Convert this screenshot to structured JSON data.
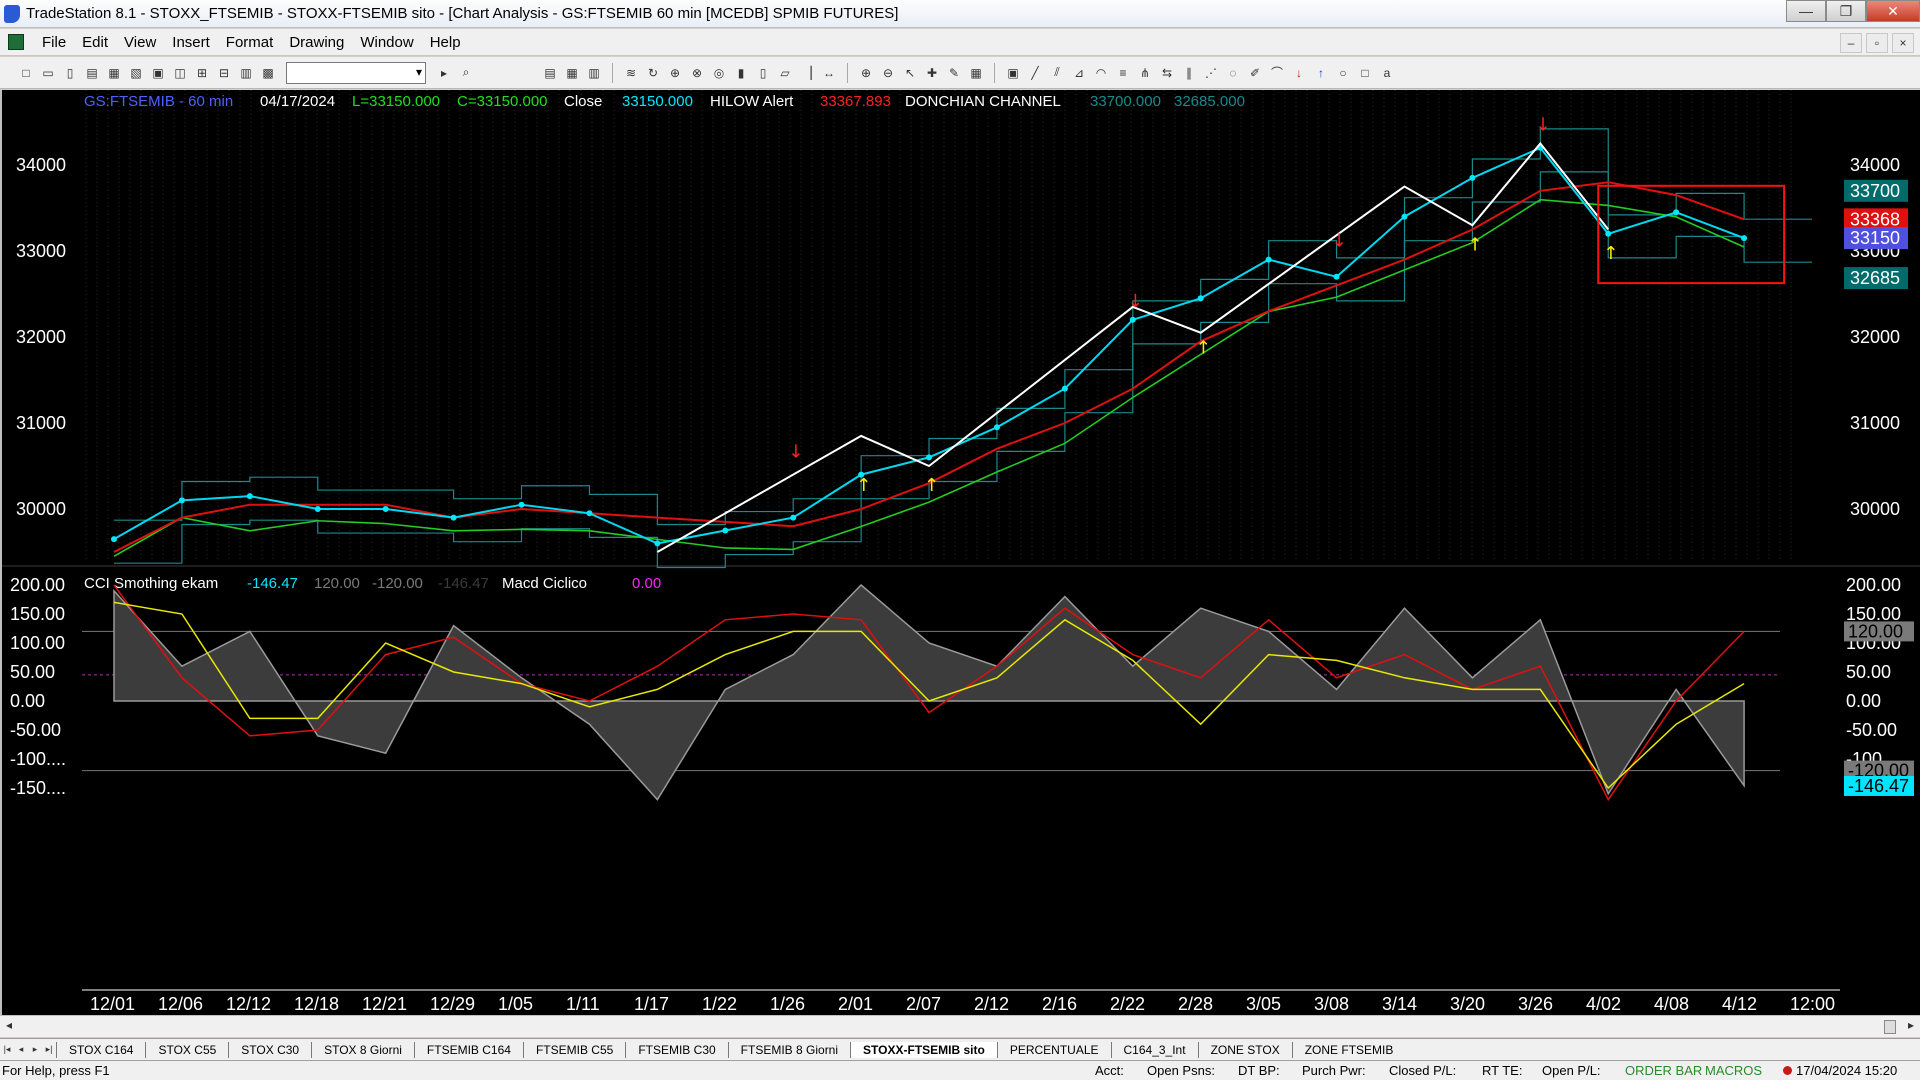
{
  "window": {
    "title": "TradeStation 8.1 - STOXX_FTSEMIB - STOXX-FTSEMIB sito - [Chart Analysis - GS:FTSEMIB  60 min  [MCEDB] SPMIB FUTURES]",
    "minimize": "—",
    "restore": "❐",
    "close": "✕"
  },
  "menu": {
    "items": [
      "File",
      "Edit",
      "View",
      "Insert",
      "Format",
      "Drawing",
      "Window",
      "Help"
    ],
    "mdi_min": "–",
    "mdi_restore": "▫",
    "mdi_close": "×"
  },
  "toolbar": {
    "left_icons": [
      "new-icon",
      "open-icon",
      "copy-icon",
      "paste-icon",
      "folder-icon",
      "print-icon",
      "print-preview-icon",
      "window-icon",
      "window2-icon",
      "lock-icon",
      "tools-icon",
      "globe-icon"
    ],
    "right_icons": [
      "grid-icon",
      "grid2-icon",
      "table-icon",
      "wave-icon",
      "refresh-icon",
      "chart-icon",
      "chart2-icon",
      "scan-icon",
      "bars-icon",
      "bars2-icon",
      "bars3-icon",
      "candles-icon",
      "hbar-icon",
      "zoom-in-icon",
      "zoom-out-icon",
      "pointer-icon",
      "cross-icon",
      "wrench-icon",
      "report-icon",
      "ticker-icon",
      "trendline-icon",
      "channel-icon",
      "fib-icon",
      "gann-icon",
      "lines-icon",
      "pitchfork-icon",
      "arrows-icon",
      "parallel-icon",
      "speed-icon",
      "cycle-icon",
      "brush-icon",
      "curve-icon",
      "down-arrow-icon",
      "up-arrow-icon",
      "ellipse-icon",
      "rectangle-icon",
      "text-icon"
    ]
  },
  "chart": {
    "header": {
      "symbol": "GS:FTSEMIB - 60 min",
      "date": "04/17/2024",
      "low": "L=33150.000",
      "close": "C=33150.000",
      "close_label": "Close",
      "close_value": "33150.000",
      "hilow_label": "HILOW Alert",
      "hilow_value": "33367.893",
      "donchian_label": "DONCHIAN CHANNEL",
      "donchian_high": "33700.000",
      "donchian_low": "32685.000"
    },
    "price_axis": [
      "34000",
      "33000",
      "32000",
      "31000",
      "30000"
    ],
    "price_tags": [
      {
        "text": "33700",
        "color": "#006b6b"
      },
      {
        "text": "33368",
        "color": "#e01010"
      },
      {
        "text": "33150",
        "color": "#5050e0"
      },
      {
        "text": "32685",
        "color": "#006b6b"
      }
    ],
    "indicator_header": {
      "name": "CCI Smothing ekam",
      "value": "-146.47",
      "upper": "120.00",
      "lower": "-120.00",
      "last": "-146.47",
      "macd_label": "Macd Ciclico",
      "macd_value": "0.00"
    },
    "indicator_axis": [
      "200.00",
      "150.00",
      "100.00",
      "50.00",
      "0.00",
      "-50.00",
      "-100....",
      "-150...."
    ],
    "indicator_tags": [
      {
        "text": "120.00",
        "color": "#7a7a7a"
      },
      {
        "text": "-120.00",
        "color": "#7a7a7a"
      },
      {
        "text": "-146.47",
        "color": "#00e5ff"
      }
    ],
    "x_axis": [
      "12/01",
      "12/06",
      "12/12",
      "12/18",
      "12/21",
      "12/29",
      "1/05",
      "1/11",
      "1/17",
      "1/22",
      "1/26",
      "2/01",
      "2/07",
      "2/12",
      "2/16",
      "2/22",
      "2/28",
      "3/05",
      "3/08",
      "3/14",
      "3/20",
      "3/26",
      "4/02",
      "4/08",
      "4/12",
      "12:00"
    ]
  },
  "chart_data": {
    "type": "line",
    "title": "GS:FTSEMIB - 60 min",
    "ylim": [
      29400,
      34500
    ],
    "x": [
      "12/01",
      "12/06",
      "12/12",
      "12/18",
      "12/21",
      "12/29",
      "1/05",
      "1/11",
      "1/17",
      "1/22",
      "1/26",
      "2/01",
      "2/07",
      "2/12",
      "2/16",
      "2/22",
      "2/28",
      "3/05",
      "3/08",
      "3/14",
      "3/20",
      "3/26",
      "4/02",
      "4/08",
      "4/12"
    ],
    "series": [
      {
        "name": "Close",
        "values": [
          29650,
          30100,
          30150,
          30000,
          30000,
          29900,
          30050,
          29950,
          29600,
          29750,
          29900,
          30400,
          30600,
          30950,
          31400,
          32200,
          32450,
          32900,
          32700,
          33400,
          33850,
          34200,
          33200,
          33450,
          33150
        ]
      },
      {
        "name": "HILOW Alert",
        "values": [
          29500,
          29900,
          30050,
          30050,
          30050,
          29900,
          30000,
          29950,
          29900,
          29850,
          29800,
          30000,
          30300,
          30700,
          31000,
          31400,
          31950,
          32300,
          32600,
          32900,
          33250,
          33700,
          33800,
          33650,
          33368
        ]
      }
    ],
    "donchian": {
      "high": 33700,
      "low": 32685
    }
  },
  "tabs": [
    "STOX C164",
    "STOX C55",
    "STOX  C30",
    "STOX  8 Giorni",
    "FTSEMIB C164",
    "FTSEMIB C55",
    "FTSEMIB C30",
    "FTSEMIB  8 Giorni",
    "STOXX-FTSEMIB sito",
    "PERCENTUALE",
    "C164_3_Int",
    "ZONE STOX",
    "ZONE FTSEMIB"
  ],
  "active_tab": "STOXX-FTSEMIB sito",
  "status": {
    "help": "For Help, press F1",
    "acct": "Acct:",
    "open_psns": "Open Psns:",
    "dt_bp": "DT BP:",
    "purch_pwr": "Purch Pwr:",
    "closed_pl": "Closed P/L:",
    "rt_te": "RT TE:",
    "open_pl": "Open P/L:",
    "order_bar": "ORDER BAR",
    "macros": "MACROS",
    "datetime": "17/04/2024 15:20"
  }
}
